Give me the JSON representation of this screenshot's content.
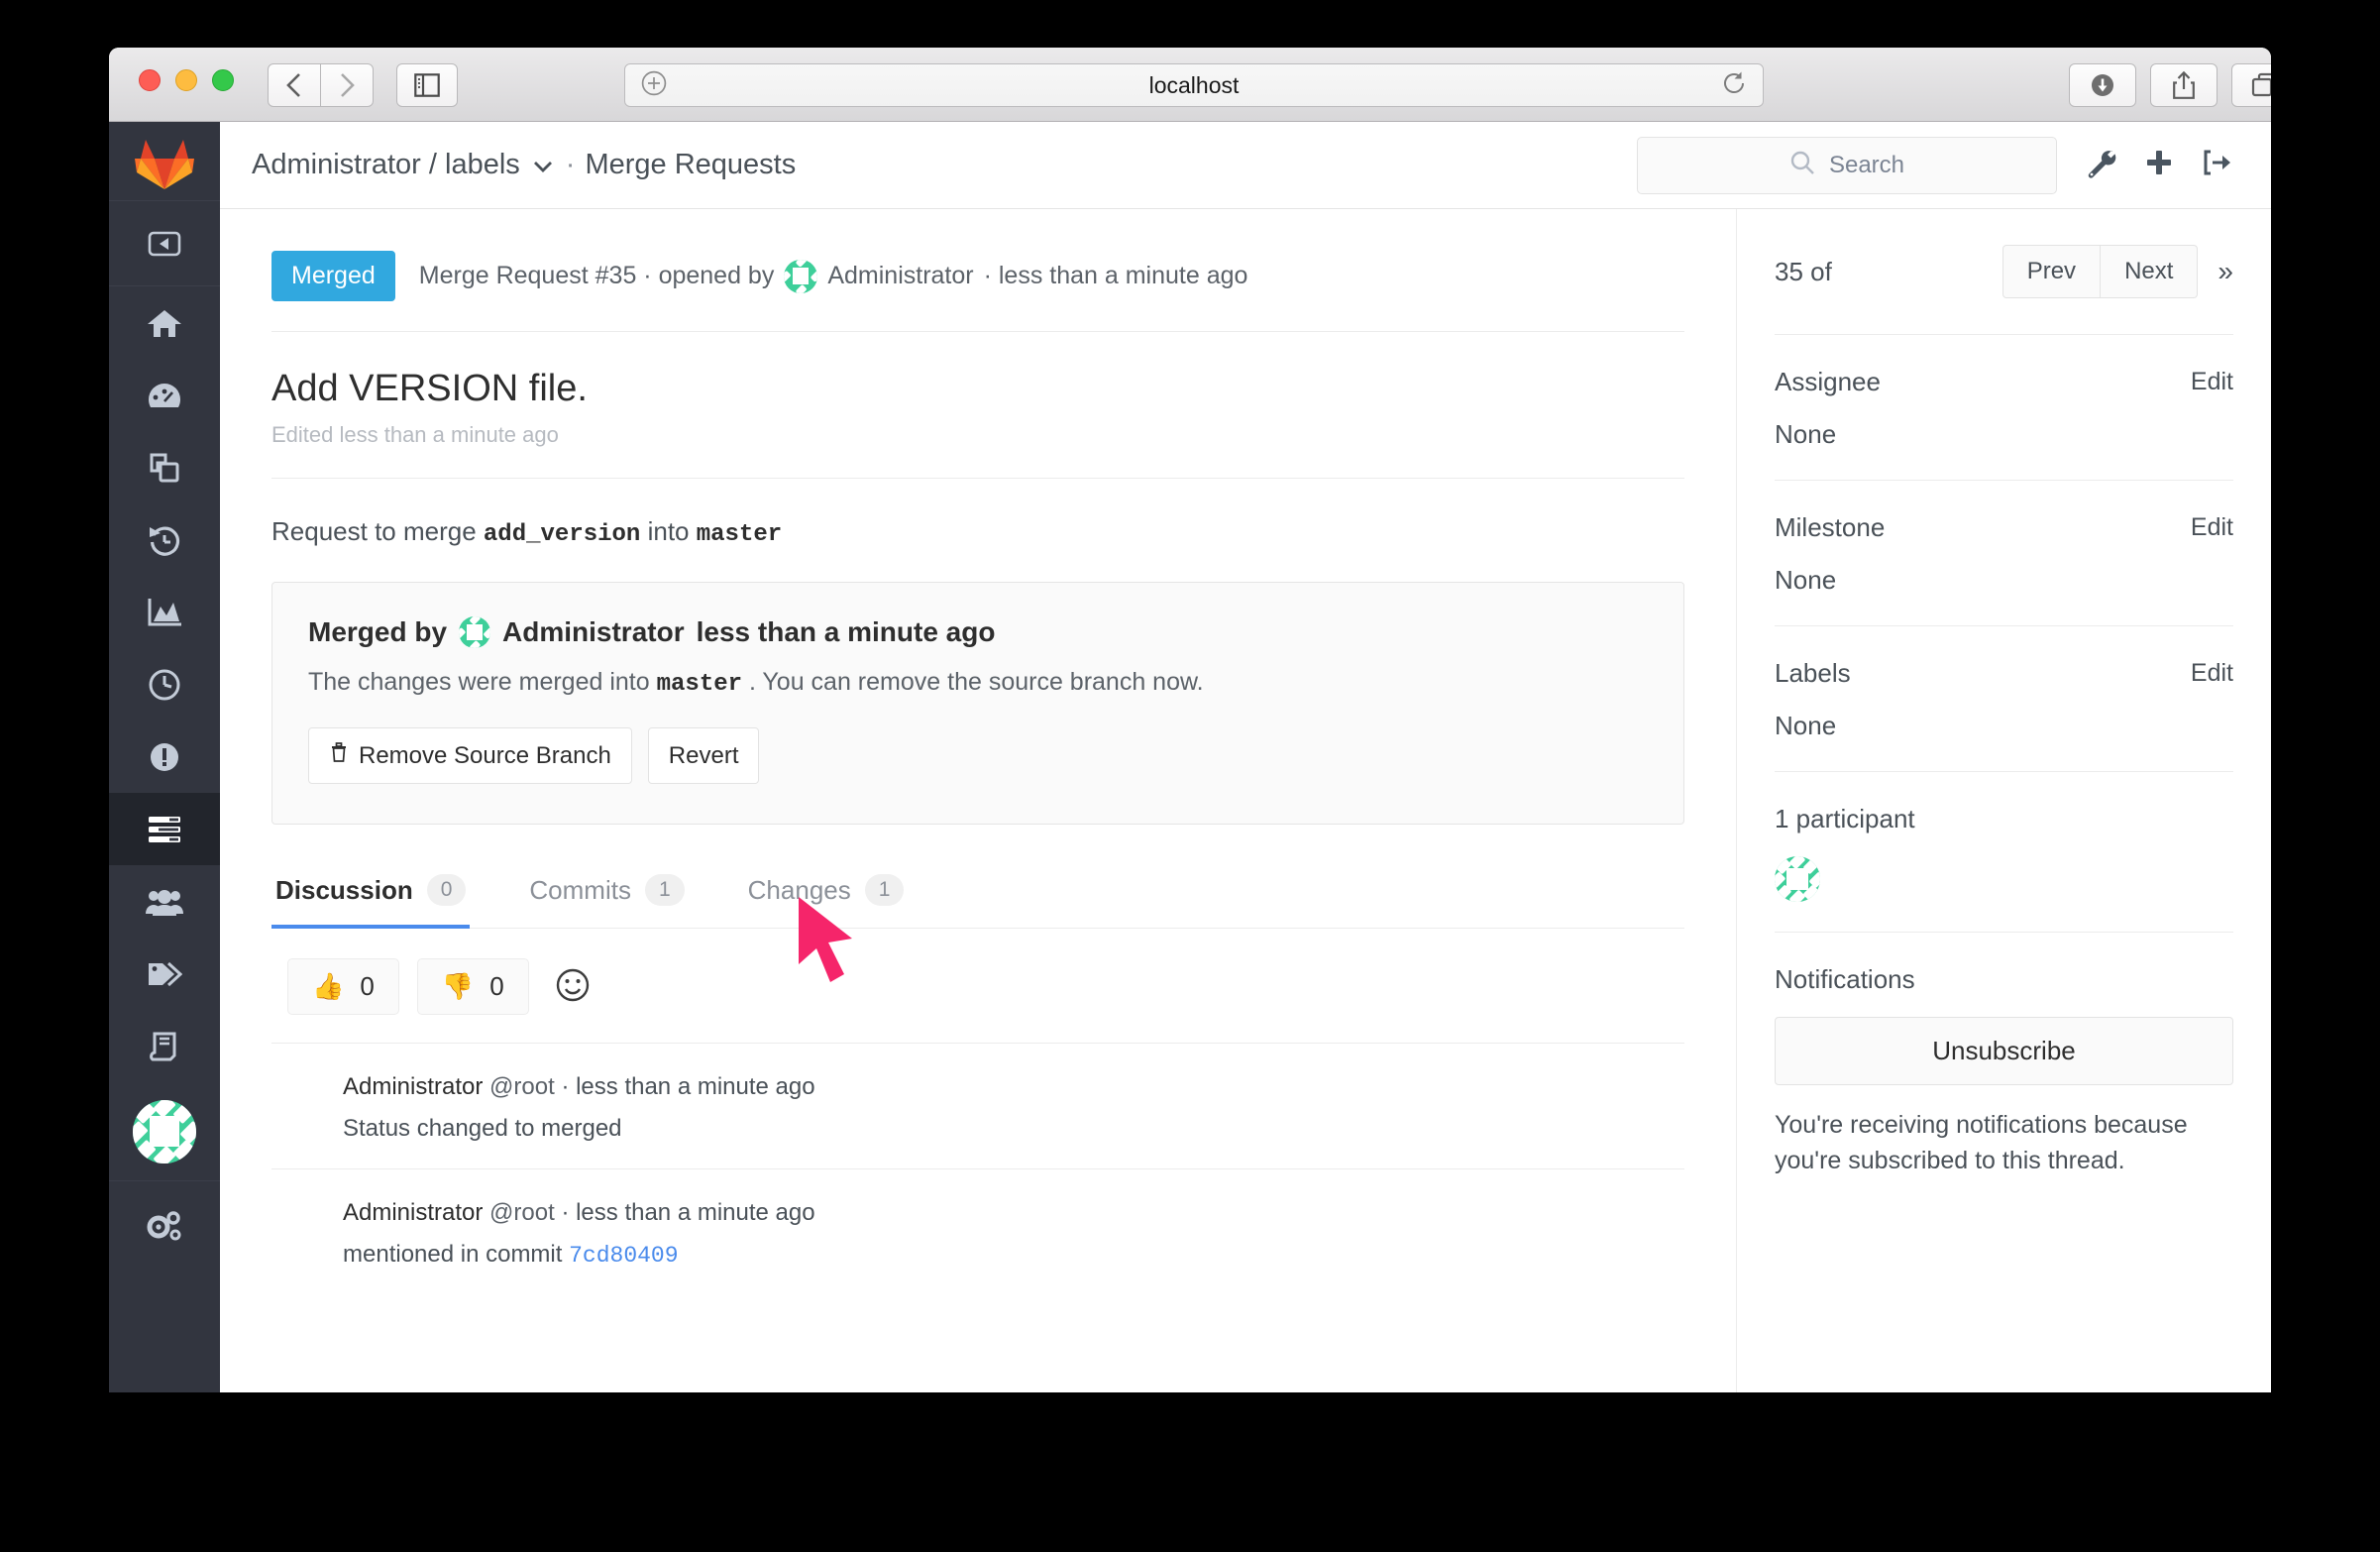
{
  "browser": {
    "url": "localhost",
    "back_icon": "chevron-left-icon",
    "forward_icon": "chevron-right-icon",
    "sidebar_icon": "sidebar-toggle-icon",
    "add_icon": "plus-circle-icon",
    "reload_icon": "reload-icon",
    "download_icon": "download-icon",
    "share_icon": "share-icon",
    "tabs_icon": "tab-overview-icon",
    "new_tab_icon": "plus-icon"
  },
  "left_nav": {
    "logo": "gitlab-logo",
    "collapse_icon": "collapse-sidebar-icon",
    "items": [
      {
        "icon": "home-icon",
        "name": "home",
        "active": false
      },
      {
        "icon": "dashboard-icon",
        "name": "dashboard",
        "active": false
      },
      {
        "icon": "files-icon",
        "name": "files",
        "active": false
      },
      {
        "icon": "history-icon",
        "name": "activity",
        "active": false
      },
      {
        "icon": "chart-icon",
        "name": "graphs",
        "active": false
      },
      {
        "icon": "clock-icon",
        "name": "pipelines",
        "active": false
      },
      {
        "icon": "issues-icon",
        "name": "issues",
        "active": false
      },
      {
        "icon": "merge-requests-icon",
        "name": "merge-requests",
        "active": true
      },
      {
        "icon": "members-icon",
        "name": "members",
        "active": false
      },
      {
        "icon": "labels-icon",
        "name": "labels",
        "active": false
      },
      {
        "icon": "wiki-icon",
        "name": "wiki",
        "active": false
      }
    ],
    "avatar": "user-avatar-identicon",
    "settings_icon": "settings-gears-icon"
  },
  "header": {
    "breadcrumb_project": "Administrator / labels",
    "breadcrumb_caret": "⌄",
    "breadcrumb_separator": "·",
    "breadcrumb_section": "Merge Requests",
    "search_placeholder": "Search",
    "search_value": "",
    "search_icon": "search-icon",
    "admin_icon": "wrench-icon",
    "new_icon": "plus-icon",
    "signout_icon": "sign-out-icon"
  },
  "merge_request": {
    "state_badge": "Merged",
    "state_badge_color": "#31a8df",
    "meta_prefix": "Merge Request #35 · opened by",
    "author": "Administrator",
    "meta_suffix": "· less than a minute ago",
    "title": "Add VERSION file.",
    "edited": "Edited less than a minute ago",
    "request_prefix": "Request to merge",
    "source_branch": "add_version",
    "request_middle": "into",
    "target_branch": "master",
    "merged_panel": {
      "merged_by_prefix": "Merged by",
      "merged_by_user": "Administrator",
      "merged_by_time": "less than a minute ago",
      "description_prefix": "The changes were merged into",
      "description_branch": "master",
      "description_suffix": ". You can remove the source branch now.",
      "remove_branch_label": "Remove Source Branch",
      "remove_branch_icon": "trash-icon",
      "revert_label": "Revert"
    },
    "tabs": [
      {
        "label": "Discussion",
        "count": "0",
        "active": true
      },
      {
        "label": "Commits",
        "count": "1",
        "active": false
      },
      {
        "label": "Changes",
        "count": "1",
        "active": false
      }
    ],
    "awards": [
      {
        "icon": "thumbs-up-icon",
        "emoji": "👍",
        "count": "0"
      },
      {
        "icon": "thumbs-down-icon",
        "emoji": "👎",
        "count": "0"
      }
    ],
    "award_add_icon": "add-reaction-smiley-icon",
    "notes": [
      {
        "user": "Administrator",
        "handle": "@root",
        "time": "· less than a minute ago",
        "body": "Status changed to merged",
        "link": ""
      },
      {
        "user": "Administrator",
        "handle": "@root",
        "time": "· less than a minute ago",
        "body": "mentioned in commit",
        "link": "7cd80409"
      }
    ]
  },
  "sidebar": {
    "count_text": "35 of",
    "prev_label": "Prev",
    "next_label": "Next",
    "collapse_icon": "»",
    "assignee_label": "Assignee",
    "assignee_edit": "Edit",
    "assignee_value": "None",
    "milestone_label": "Milestone",
    "milestone_edit": "Edit",
    "milestone_value": "None",
    "labels_label": "Labels",
    "labels_edit": "Edit",
    "labels_value": "None",
    "participants_text": "1 participant",
    "participant_avatar": "participant-avatar-identicon",
    "notifications_label": "Notifications",
    "unsubscribe_label": "Unsubscribe",
    "notifications_description": "You're receiving notifications because you're subscribed to this thread."
  },
  "cursor": {
    "color": "#f5256a",
    "name": "mouse-pointer"
  }
}
